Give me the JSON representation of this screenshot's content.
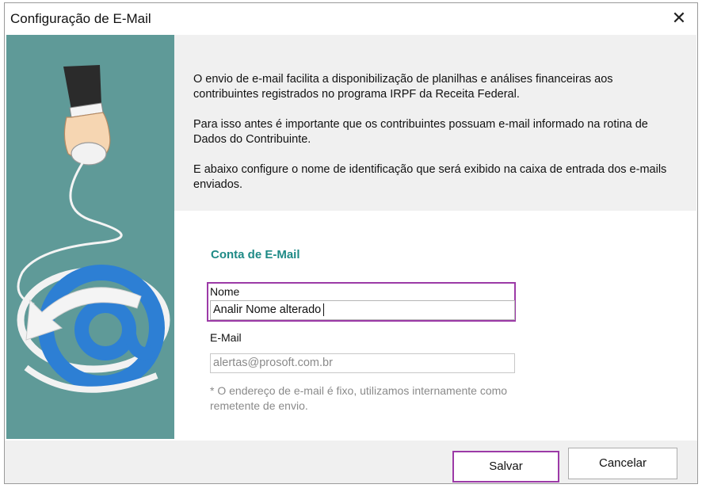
{
  "window": {
    "title": "Configuração de E-Mail"
  },
  "icons": {
    "close": "close-icon",
    "illustration": "hand-mouse-email-at-illustration"
  },
  "colors": {
    "side_panel": "#5f9a98",
    "section_title": "#1e8a86",
    "highlight": "#9c3aa7",
    "at_symbol": "#2d7fd4"
  },
  "info": {
    "paragraphs": [
      "O envio de e-mail facilita a disponibilização de planilhas e análises financeiras aos contribuintes registrados no programa IRPF da Receita Federal.",
      "Para isso antes é importante que os contribuintes possuam e-mail informado na rotina de Dados do Contribuinte.",
      "E abaixo configure o nome de identificação que será exibido na caixa de entrada dos e-mails enviados."
    ]
  },
  "form": {
    "section_title": "Conta de E-Mail",
    "name_label": "Nome",
    "name_value": "Analir Nome alterado",
    "email_label": "E-Mail",
    "email_value": "alertas@prosoft.com.br",
    "note": "* O endereço de e-mail é fixo, utilizamos internamente como remetente de envio."
  },
  "buttons": {
    "save": "Salvar",
    "cancel": "Cancelar"
  }
}
